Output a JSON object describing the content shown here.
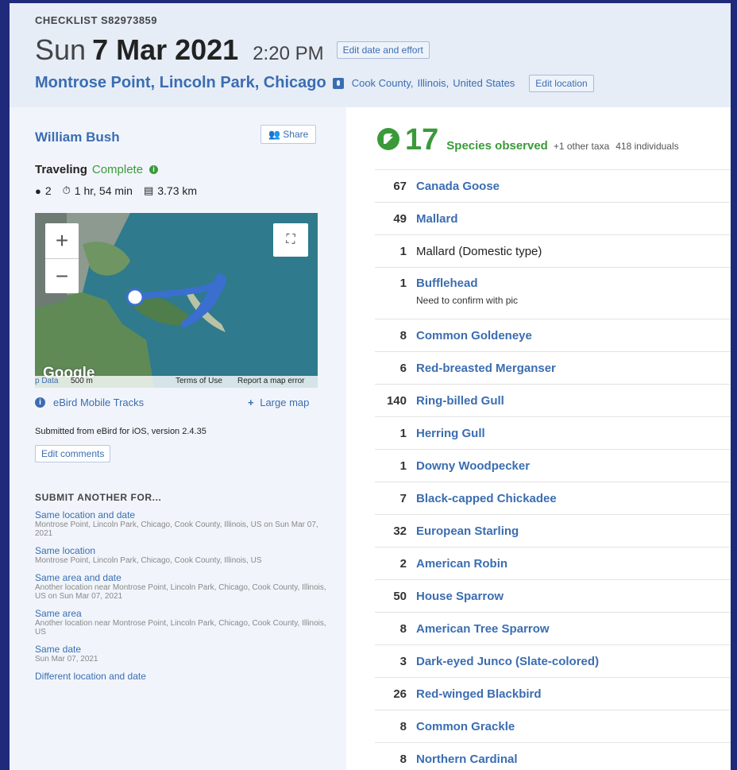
{
  "header": {
    "checklist_id": "CHECKLIST S82973859",
    "date_day": "Sun",
    "date_main": "7 Mar 2021",
    "time": "2:20 PM",
    "edit_date_label": "Edit date and effort",
    "location_name": "Montrose Point, Lincoln Park, Chicago",
    "location_icon": "map-pin-icon",
    "county": "Cook County,",
    "state": "Illinois,",
    "country": "United States",
    "edit_location_label": "Edit location"
  },
  "sidebar": {
    "observer": "William Bush",
    "share_label": "Share",
    "protocol": "Traveling",
    "status": "Complete",
    "observers_count": "2",
    "duration": "1 hr, 54 min",
    "distance": "3.73 km",
    "map": {
      "zoom_in": "+",
      "zoom_out": "−",
      "google": "Google",
      "map_data": "p Data",
      "scale": "500 m",
      "terms": "Terms of Use",
      "report": "Report a map error"
    },
    "tracks_label": "eBird Mobile Tracks",
    "large_map_label": "Large map",
    "submitted": "Submitted from eBird for iOS, version 2.4.35",
    "edit_comments_label": "Edit comments",
    "submit_title": "SUBMIT ANOTHER FOR...",
    "submit_options": [
      {
        "label": "Same location and date",
        "desc": "Montrose Point, Lincoln Park, Chicago, Cook County, Illinois, US on Sun Mar 07, 2021"
      },
      {
        "label": "Same location",
        "desc": "Montrose Point, Lincoln Park, Chicago, Cook County, Illinois, US"
      },
      {
        "label": "Same area and date",
        "desc": "Another location near Montrose Point, Lincoln Park, Chicago, Cook County, Illinois, US on Sun Mar 07, 2021"
      },
      {
        "label": "Same area",
        "desc": "Another location near Montrose Point, Lincoln Park, Chicago, Cook County, Illinois, US"
      },
      {
        "label": "Same date",
        "desc": "Sun Mar 07, 2021"
      },
      {
        "label": "Different location and date",
        "desc": ""
      }
    ]
  },
  "summary": {
    "species_count": "17",
    "species_label": "Species observed",
    "other_taxa": "+1 other taxa",
    "individuals": "418 individuals",
    "accent": "#3a9a3a"
  },
  "observations": [
    {
      "count": "67",
      "name": "Canada Goose",
      "link": true,
      "comment": ""
    },
    {
      "count": "49",
      "name": "Mallard",
      "link": true,
      "comment": ""
    },
    {
      "count": "1",
      "name": "Mallard (Domestic type)",
      "link": false,
      "comment": ""
    },
    {
      "count": "1",
      "name": "Bufflehead",
      "link": true,
      "comment": "Need to confirm with pic"
    },
    {
      "count": "8",
      "name": "Common Goldeneye",
      "link": true,
      "comment": ""
    },
    {
      "count": "6",
      "name": "Red-breasted Merganser",
      "link": true,
      "comment": ""
    },
    {
      "count": "140",
      "name": "Ring-billed Gull",
      "link": true,
      "comment": ""
    },
    {
      "count": "1",
      "name": "Herring Gull",
      "link": true,
      "comment": ""
    },
    {
      "count": "1",
      "name": "Downy Woodpecker",
      "link": true,
      "comment": ""
    },
    {
      "count": "7",
      "name": "Black-capped Chickadee",
      "link": true,
      "comment": ""
    },
    {
      "count": "32",
      "name": "European Starling",
      "link": true,
      "comment": ""
    },
    {
      "count": "2",
      "name": "American Robin",
      "link": true,
      "comment": ""
    },
    {
      "count": "50",
      "name": "House Sparrow",
      "link": true,
      "comment": ""
    },
    {
      "count": "8",
      "name": "American Tree Sparrow",
      "link": true,
      "comment": ""
    },
    {
      "count": "3",
      "name": "Dark-eyed Junco (Slate-colored)",
      "link": true,
      "comment": ""
    },
    {
      "count": "26",
      "name": "Red-winged Blackbird",
      "link": true,
      "comment": ""
    },
    {
      "count": "8",
      "name": "Common Grackle",
      "link": true,
      "comment": ""
    },
    {
      "count": "8",
      "name": "Northern Cardinal",
      "link": true,
      "comment": ""
    }
  ]
}
